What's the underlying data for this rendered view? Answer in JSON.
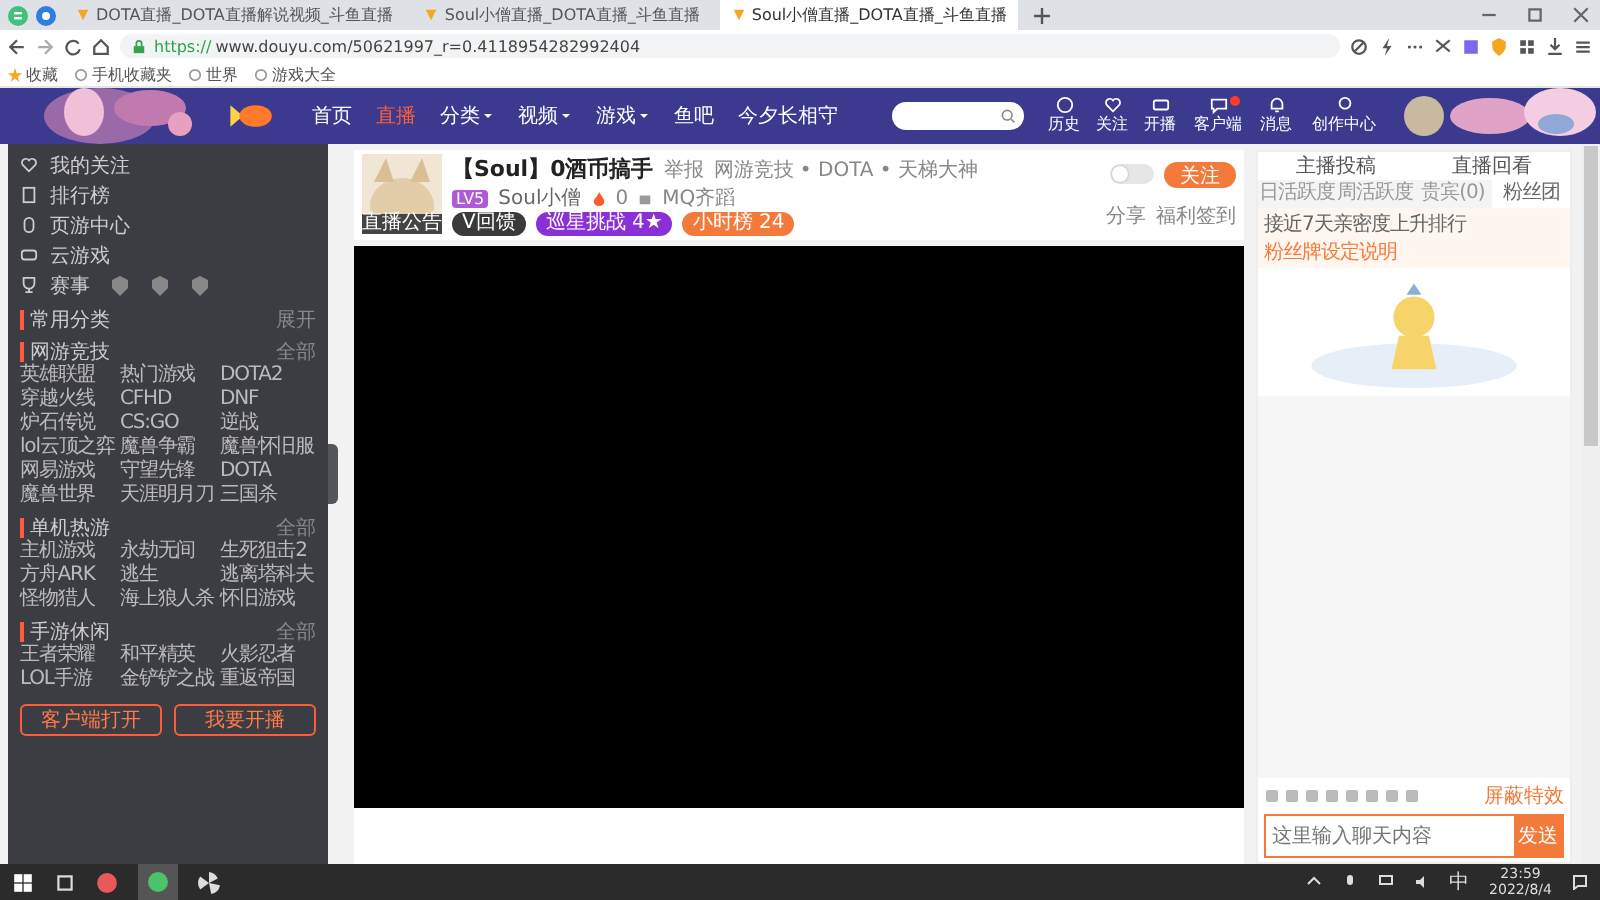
{
  "browser": {
    "tabs": [
      {
        "title": "DOTA直播_DOTA直播解说视频_斗鱼直播",
        "selected": false
      },
      {
        "title": "Soul小僧直播_DOTA直播_斗鱼直播",
        "selected": false
      },
      {
        "title": "Soul小僧直播_DOTA直播_斗鱼直播",
        "selected": true
      }
    ],
    "url_scheme": "https://",
    "url_rest": "www.douyu.com/50621997_r=0.4118954282992404",
    "bookmarks": [
      "收藏",
      "手机收藏夹",
      "世界",
      "游戏大全"
    ]
  },
  "site_header": {
    "nav": [
      {
        "label": "首页",
        "selected": false,
        "dropdown": false
      },
      {
        "label": "直播",
        "selected": true,
        "dropdown": false
      },
      {
        "label": "分类",
        "selected": false,
        "dropdown": true
      },
      {
        "label": "视频",
        "selected": false,
        "dropdown": true
      },
      {
        "label": "游戏",
        "selected": false,
        "dropdown": true
      },
      {
        "label": "鱼吧",
        "selected": false,
        "dropdown": false
      },
      {
        "label": "今夕长相守",
        "selected": false,
        "dropdown": false
      }
    ],
    "actions": [
      {
        "label": "历史",
        "badge": false
      },
      {
        "label": "关注",
        "badge": false
      },
      {
        "label": "开播",
        "badge": false
      },
      {
        "label": "客户端",
        "badge": true
      },
      {
        "label": "消息",
        "badge": false
      },
      {
        "label": "创作中心",
        "badge": false
      }
    ]
  },
  "sidebar": {
    "nav": [
      "我的关注",
      "排行榜",
      "页游中心",
      "云游戏",
      "赛事"
    ],
    "sections": [
      {
        "title": "常用分类",
        "more": "展开"
      },
      {
        "title": "网游竞技",
        "more": "全部",
        "items": [
          "英雄联盟",
          "热门游戏",
          "DOTA2",
          "穿越火线",
          "CFHD",
          "DNF",
          "炉石传说",
          "CS:GO",
          "逆战",
          "lol云顶之弈",
          "魔兽争霸",
          "魔兽怀旧服",
          "网易游戏",
          "守望先锋",
          "DOTA",
          "魔兽世界",
          "天涯明月刀",
          "三国杀"
        ]
      },
      {
        "title": "单机热游",
        "more": "全部",
        "items": [
          "主机游戏",
          "永劫无间",
          "生死狙击2",
          "方舟ARK",
          "逃生",
          "逃离塔科夫",
          "怪物猎人",
          "海上狼人杀",
          "怀旧游戏"
        ]
      },
      {
        "title": "手游休闲",
        "more": "全部",
        "items": [
          "王者荣耀",
          "和平精英",
          "火影忍者",
          "LOL手游",
          "金铲铲之战",
          "重返帝国"
        ]
      }
    ],
    "buttons": [
      "客户端打开",
      "我要开播"
    ]
  },
  "stream": {
    "title": "【Soul】0酒币搞手",
    "report": "举报",
    "category": "网游竞技 • DOTA • 天梯大神",
    "avatar_tags": [
      "直播",
      "公告"
    ],
    "level": "LV5",
    "anchor": "Soul小僧",
    "heat": "0",
    "team": "MQ齐蹈",
    "badges": [
      {
        "label": "V回馈",
        "color": "#3a3a3a"
      },
      {
        "label": "巡星挑战 4★",
        "color": "#8b2fd6"
      },
      {
        "label": "小时榜 24",
        "color": "#f47a3b"
      }
    ],
    "toggle_on": false,
    "follow": "关注",
    "share": "分享",
    "checkin": "福利签到"
  },
  "right_panel": {
    "links": [
      "主播投稿",
      "直播回看"
    ],
    "tabs": [
      {
        "label": "日活跃度",
        "selected": false
      },
      {
        "label": "周活跃度",
        "selected": false
      },
      {
        "label": "贵宾(0)",
        "selected": false
      },
      {
        "label": "粉丝团",
        "selected": true
      }
    ],
    "notice": "接近7天亲密度上升排行",
    "notice_link": "粉丝牌设定说明",
    "shield": "屏蔽特效",
    "input_placeholder": "这里输入聊天内容",
    "send": "发送"
  },
  "taskbar": {
    "ime": "中",
    "time": "23:59",
    "date": "2022/8/4"
  }
}
